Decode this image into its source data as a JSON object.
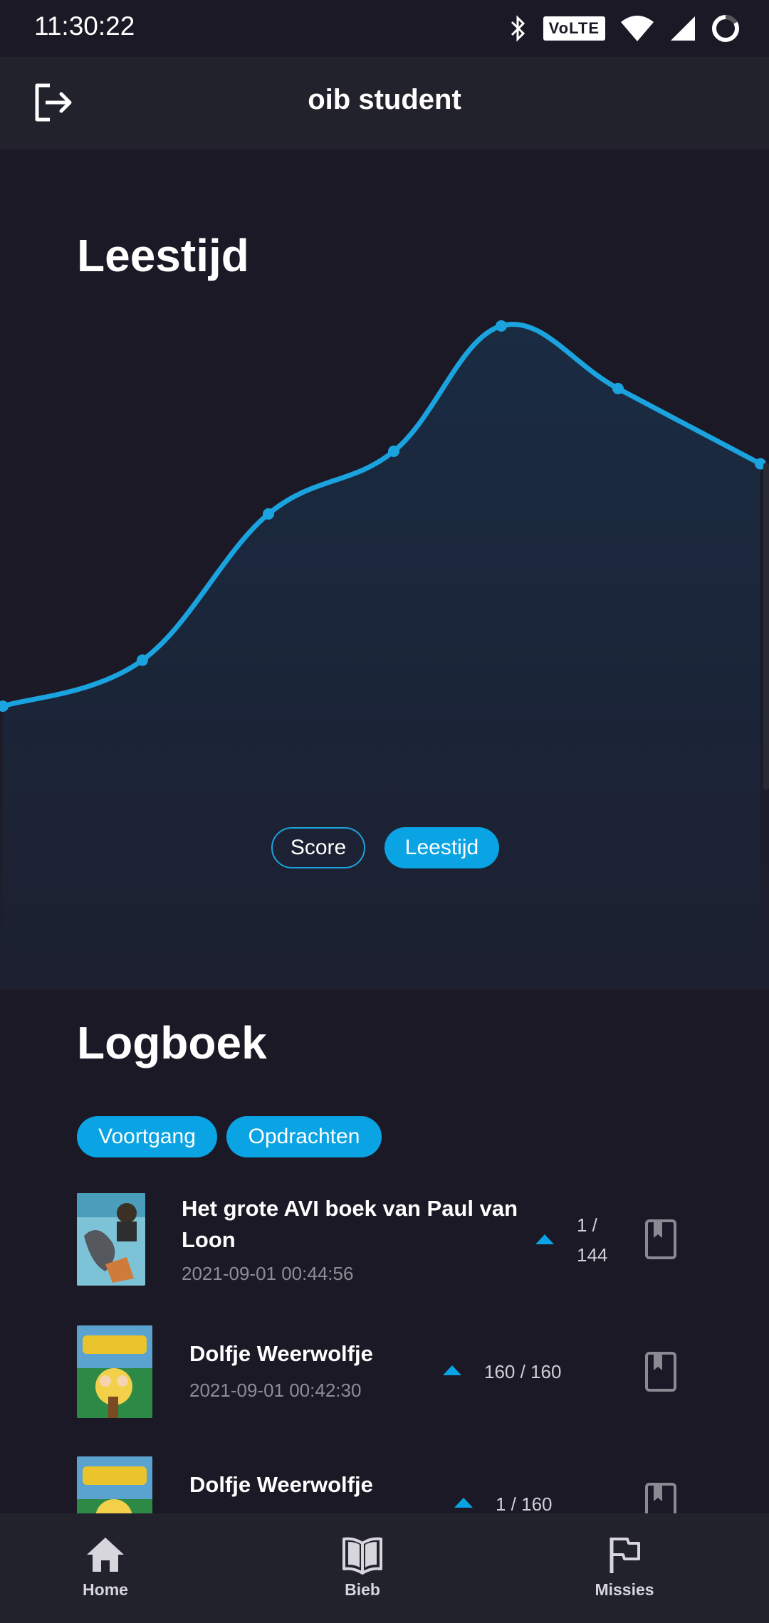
{
  "status_bar": {
    "time": "11:30:22",
    "volte": "VoLTE"
  },
  "app_bar": {
    "title": "oib student"
  },
  "chart_section": {
    "title": "Leestijd",
    "toggle": [
      {
        "label": "Score",
        "active": false
      },
      {
        "label": "Leestijd",
        "active": true
      }
    ]
  },
  "chart_data": {
    "type": "area",
    "title": "Leestijd",
    "x": [
      1,
      2,
      3,
      4,
      5,
      6,
      7
    ],
    "values": [
      0,
      11,
      46,
      61,
      91,
      76,
      58
    ],
    "xlabel": "",
    "ylabel": "",
    "ylim": [
      0,
      100
    ],
    "grid": false,
    "line_color": "#1aa3de",
    "fill_color": "#1a2a40"
  },
  "logbook": {
    "title": "Logboek",
    "tabs": [
      {
        "label": "Voortgang"
      },
      {
        "label": "Opdrachten"
      }
    ],
    "entries": [
      {
        "title_line1": "Het grote AVI boek van Paul van",
        "title_line2": "Loon",
        "date": "2021-09-01 00:44:56",
        "progress_line1": "1 /",
        "progress_line2": "144",
        "cover": "grote-avi-cover"
      },
      {
        "title_line1": "Dolfje Weerwolfje",
        "date": "2021-09-01 00:42:30",
        "progress": "160 / 160",
        "cover": "dolfje-cover"
      },
      {
        "title_line1": "Dolfje Weerwolfje",
        "progress": "1 / 160",
        "cover": "dolfje-cover"
      }
    ]
  },
  "bottom_nav": {
    "items": [
      {
        "label": "Home",
        "icon": "home-icon"
      },
      {
        "label": "Bieb",
        "icon": "book-open-icon"
      },
      {
        "label": "Missies",
        "icon": "flag-icon"
      }
    ]
  },
  "colors": {
    "accent": "#0aa3e3",
    "background": "#1b1925",
    "bar": "#22222d"
  }
}
